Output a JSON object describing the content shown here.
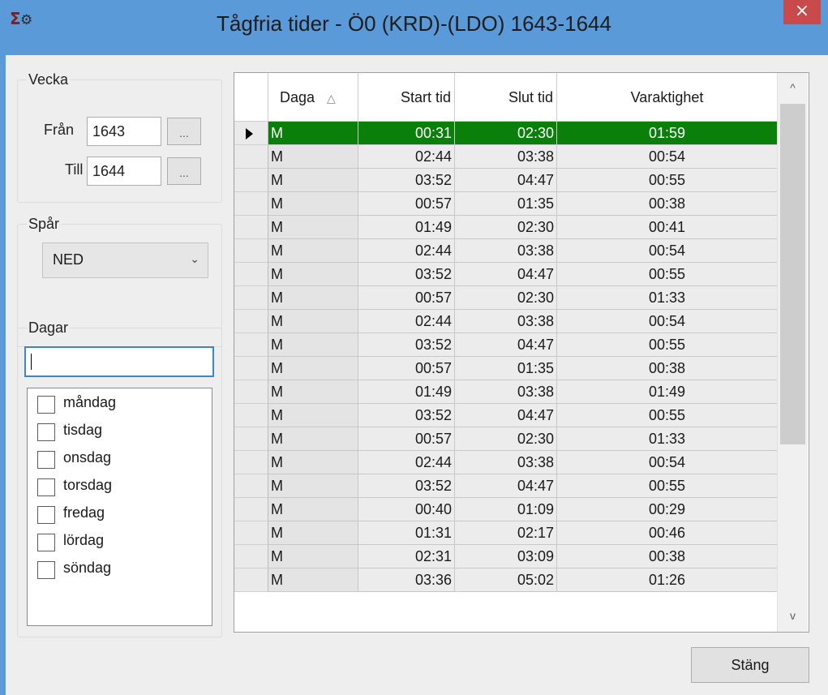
{
  "window": {
    "title": "Tågfria tider - Ö0 (KRD)-(LDO) 1643-1644",
    "close_glyph": "×",
    "app_icon": "sigma-gear-icon"
  },
  "vecka": {
    "label": "Vecka",
    "fran_label": "Från",
    "fran_value": "1643",
    "till_label": "Till",
    "till_value": "1644",
    "browse_label": "..."
  },
  "spar": {
    "label": "Spår",
    "selected": "NED",
    "arrow_glyph": "⌄"
  },
  "dagar": {
    "label": "Dagar",
    "search_value": "",
    "days": [
      "måndag",
      "tisdag",
      "onsdag",
      "torsdag",
      "fredag",
      "lördag",
      "söndag"
    ]
  },
  "grid": {
    "columns": [
      "Daga",
      "Start tid",
      "Slut tid",
      "Varaktighet"
    ],
    "sort_glyph": "△",
    "selected_row": 0,
    "selected_color": "#0a7f0a",
    "rows": [
      [
        "M",
        "00:31",
        "02:30",
        "01:59"
      ],
      [
        "M",
        "02:44",
        "03:38",
        "00:54"
      ],
      [
        "M",
        "03:52",
        "04:47",
        "00:55"
      ],
      [
        "M",
        "00:57",
        "01:35",
        "00:38"
      ],
      [
        "M",
        "01:49",
        "02:30",
        "00:41"
      ],
      [
        "M",
        "02:44",
        "03:38",
        "00:54"
      ],
      [
        "M",
        "03:52",
        "04:47",
        "00:55"
      ],
      [
        "M",
        "00:57",
        "02:30",
        "01:33"
      ],
      [
        "M",
        "02:44",
        "03:38",
        "00:54"
      ],
      [
        "M",
        "03:52",
        "04:47",
        "00:55"
      ],
      [
        "M",
        "00:57",
        "01:35",
        "00:38"
      ],
      [
        "M",
        "01:49",
        "03:38",
        "01:49"
      ],
      [
        "M",
        "03:52",
        "04:47",
        "00:55"
      ],
      [
        "M",
        "00:57",
        "02:30",
        "01:33"
      ],
      [
        "M",
        "02:44",
        "03:38",
        "00:54"
      ],
      [
        "M",
        "03:52",
        "04:47",
        "00:55"
      ],
      [
        "M",
        "00:40",
        "01:09",
        "00:29"
      ],
      [
        "M",
        "01:31",
        "02:17",
        "00:46"
      ],
      [
        "M",
        "02:31",
        "03:09",
        "00:38"
      ],
      [
        "M",
        "03:36",
        "05:02",
        "01:26"
      ]
    ]
  },
  "scrollbar": {
    "up_glyph": "^",
    "down_glyph": "v"
  },
  "footer": {
    "close_label": "Stäng"
  }
}
